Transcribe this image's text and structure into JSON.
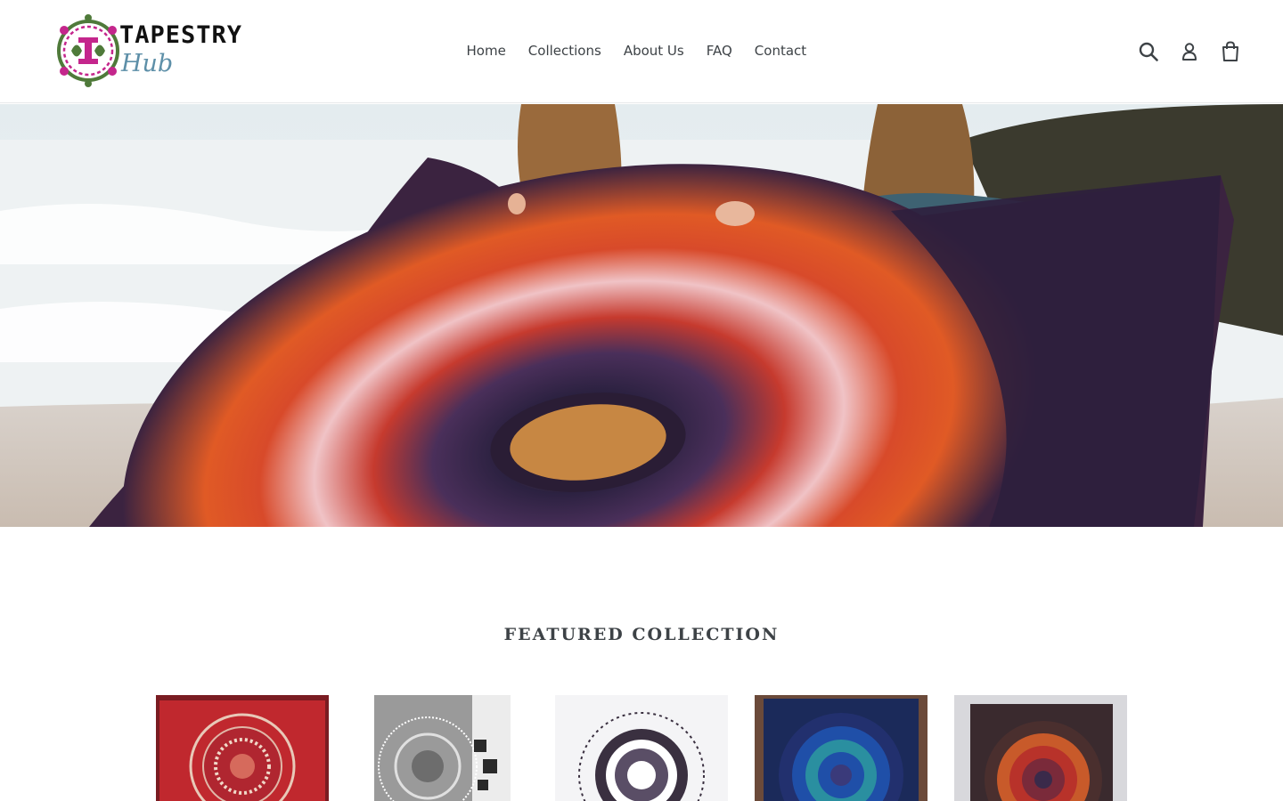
{
  "brand": {
    "name_line1": "TAPESTRY",
    "name_line2": "Hub",
    "icon": "tapestry-hub-logo"
  },
  "nav": {
    "items": [
      {
        "label": "Home"
      },
      {
        "label": "Collections"
      },
      {
        "label": "About Us"
      },
      {
        "label": "FAQ"
      },
      {
        "label": "Contact"
      }
    ]
  },
  "header_icons": [
    "search-icon",
    "account-icon",
    "cart-icon"
  ],
  "hero": {
    "image": "two women holding red mandala tapestry on beach"
  },
  "featured": {
    "title": "FEATURED COLLECTION",
    "products": [
      {
        "image": "red elephant mandala tapestry",
        "accent": "#c0282e"
      },
      {
        "image": "grey white mandala tapestry in room",
        "accent": "#8d8d8d"
      },
      {
        "image": "black and white mandala tapestry",
        "accent": "#3a3040"
      },
      {
        "image": "blue peacock mandala tapestry",
        "accent": "#1f4fa8"
      },
      {
        "image": "brown red peacock mandala tapestry",
        "accent": "#b8322a"
      }
    ]
  },
  "colors": {
    "text": "#3d4246",
    "border": "#e8e9eb",
    "logo_accent": "#c4268c",
    "logo_green": "#4f7a3a",
    "logo_blue": "#5d8fa8"
  }
}
